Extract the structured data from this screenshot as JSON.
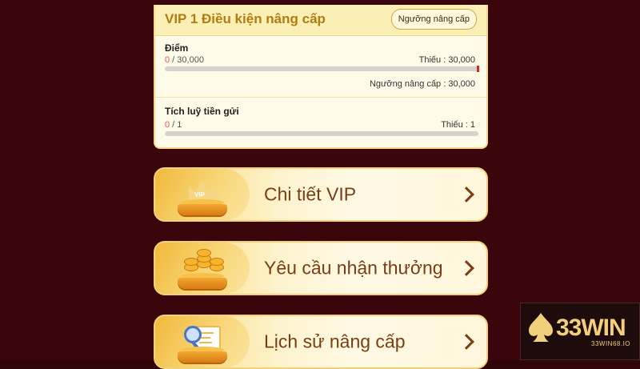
{
  "vip_card": {
    "title": "VIP 1 Điều kiện nâng cấp",
    "threshold_button": "Ngưỡng nâng cấp",
    "points": {
      "label": "Điểm",
      "current": "0",
      "target": " / 30,000",
      "missing": "Thiếu : 30,000",
      "threshold": "Ngưỡng nâng cấp : 30,000",
      "progress": 0
    },
    "deposit": {
      "label": "Tích luỹ tiền gửi",
      "current": "0",
      "target": " / 1",
      "missing": "Thiếu : 1",
      "progress": 0
    }
  },
  "menu": [
    {
      "label": "Chi tiết VIP",
      "icon": "vip-crown-icon"
    },
    {
      "label": "Yêu cầu nhận thưởng",
      "icon": "coins-icon"
    },
    {
      "label": "Lịch sử nâng cấp",
      "icon": "history-document-icon"
    }
  ],
  "logo": {
    "text": "33WIN",
    "sub": "33WIN68.IO"
  },
  "colors": {
    "background": "#3a060b",
    "accent_gold": "#f6c453",
    "label_brown": "#7a3d12",
    "progress_red": "#e0564a"
  }
}
